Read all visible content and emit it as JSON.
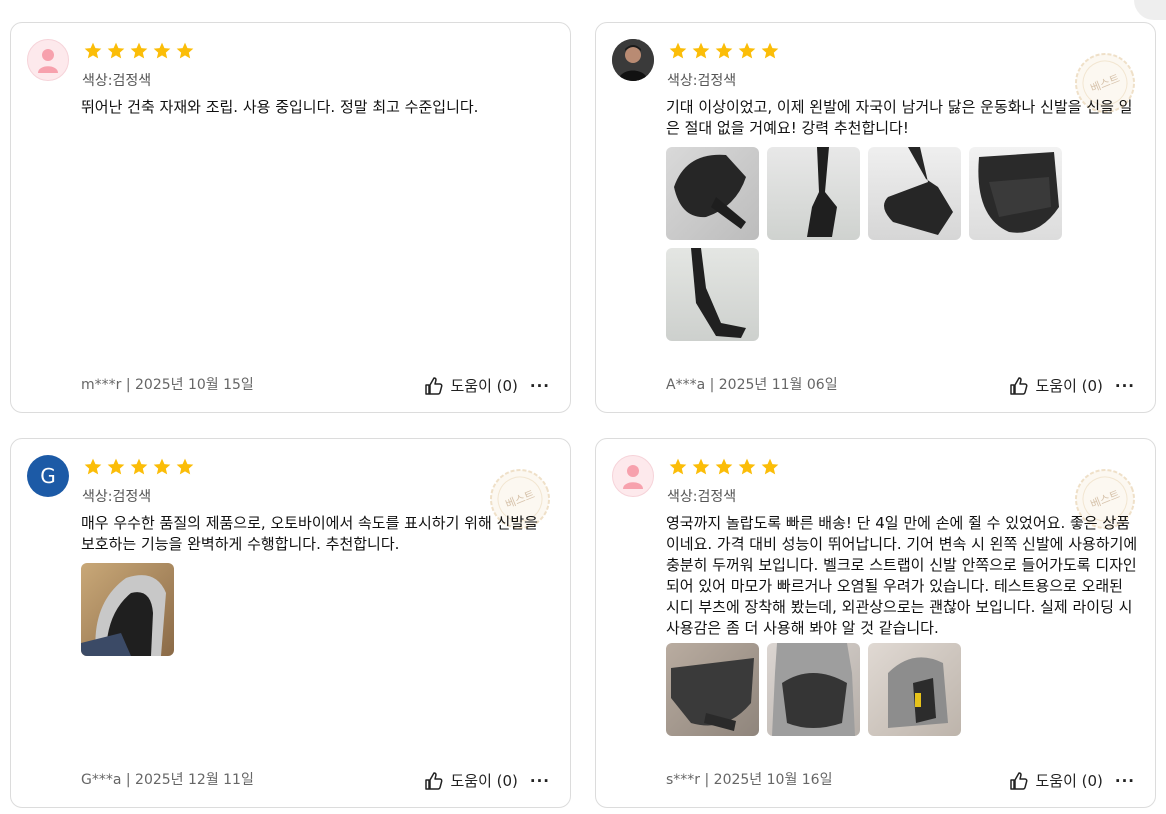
{
  "reviews": [
    {
      "color_option": "색상:검정색",
      "text": "뛰어난 건축 자재와 조립. 사용 중입니다. 정말 최고 수준입니다.",
      "user": "m***r | 2025년 10월 15일",
      "helpful": "도움이 (0)",
      "rating": 5,
      "avatar_type": "default-pink-person",
      "badge": "",
      "images": []
    },
    {
      "color_option": "색상:검정색",
      "text": "기대 이상이었고, 이제 왼발에 자국이 남거나 닳은 운동화나 신발을 신을 일은 절대 없을 거예요! 강력 추천합니다!",
      "user": "A***a | 2025년 11월 06일",
      "helpful": "도움이 (0)",
      "rating": 5,
      "avatar_type": "photo",
      "badge": "베스트",
      "images": [
        "shoe-protector-photo-1",
        "shoe-protector-photo-2",
        "shoe-protector-photo-3",
        "shoe-protector-photo-4",
        "shoe-protector-photo-5"
      ]
    },
    {
      "color_option": "색상:검정색",
      "text": "매우 우수한 품질의 제품으로, 오토바이에서 속도를 표시하기 위해 신발을 보호하는 기능을 완벽하게 수행합니다. 추천합니다.",
      "user": "G***a | 2025년 12월 11일",
      "helpful": "도움이 (0)",
      "rating": 5,
      "avatar_type": "letter",
      "avatar_letter": "G",
      "badge": "베스트",
      "images": [
        "shoe-on-foot-photo"
      ]
    },
    {
      "color_option": "색상:검정색",
      "text": "영국까지 놀랍도록 빠른 배송! 단 4일 만에 손에 쥘 수 있었어요. 좋은 상품이네요. 가격 대비 성능이 뛰어납니다. 기어 변속 시 왼쪽 신발에 사용하기에 충분히 두꺼워 보입니다. 벨크로 스트랩이 신발 안쪽으로 들어가도록 디자인되어 있어 마모가 빠르거나 오염될 우려가 있습니다. 테스트용으로 오래된 시디 부츠에 장착해 봤는데, 외관상으로는 괜찮아 보입니다. 실제 라이딩 시 사용감은 좀 더 사용해 봐야 알 것 같습니다.",
      "user": "s***r | 2025년 10월 16일",
      "helpful": "도움이 (0)",
      "rating": 5,
      "avatar_type": "default-pink-person",
      "badge": "베스트",
      "images": [
        "protector-pad-photo",
        "protector-on-boot-photo",
        "protector-side-photo"
      ]
    }
  ],
  "colors": {
    "star": "#fbbd08",
    "badge": "#d9b98a",
    "border": "#dcdcdc"
  }
}
